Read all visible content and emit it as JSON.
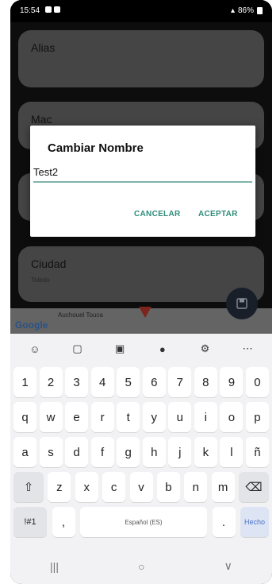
{
  "status_bar": {
    "time": "15:54",
    "battery": "86%"
  },
  "cards": [
    {
      "label": "Alias",
      "sub": ""
    },
    {
      "label": "Mac",
      "sub": ""
    },
    {
      "label": "",
      "sub": ""
    },
    {
      "label": "Ciudad",
      "sub": "Toledo"
    }
  ],
  "map": {
    "brand": "Google",
    "place_name": "Auchouel Touca"
  },
  "dialog": {
    "title": "Cambiar Nombre",
    "input_value": "Test2",
    "cancel_label": "CANCELAR",
    "accept_label": "ACEPTAR",
    "accent_color": "#2e8b7a"
  },
  "keyboard": {
    "number_row": [
      "1",
      "2",
      "3",
      "4",
      "5",
      "6",
      "7",
      "8",
      "9",
      "0"
    ],
    "row1": [
      "q",
      "w",
      "e",
      "r",
      "t",
      "y",
      "u",
      "i",
      "o",
      "p"
    ],
    "row2": [
      "a",
      "s",
      "d",
      "f",
      "g",
      "h",
      "j",
      "k",
      "l",
      "ñ"
    ],
    "row3": [
      "z",
      "x",
      "c",
      "v",
      "b",
      "n",
      "m"
    ],
    "symbols_label": "!#1",
    "comma": ",",
    "space_label": "Español (ES)",
    "period": ".",
    "done_label": "Hecho",
    "toolbar_icons": [
      "emoji-icon",
      "clipboard-icon",
      "text-icon",
      "mic-icon",
      "settings-icon",
      "more-icon"
    ]
  },
  "nav_icons": [
    "recents-icon",
    "home-icon",
    "back-icon"
  ]
}
